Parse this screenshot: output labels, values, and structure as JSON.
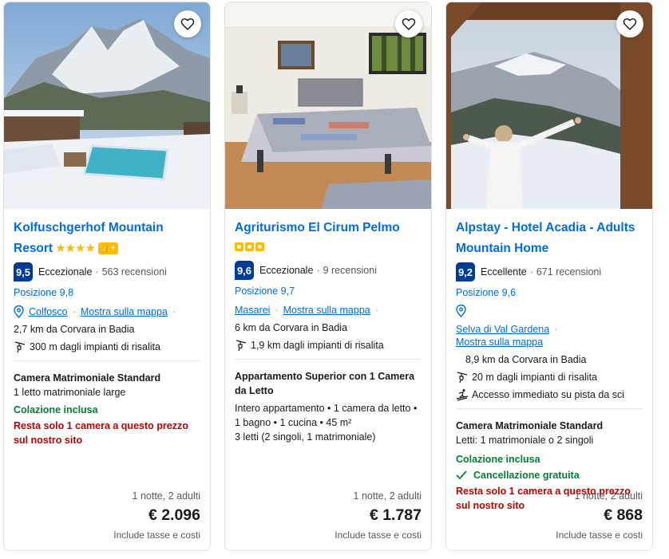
{
  "cards": [
    {
      "name": "Kolfuschgerhof Mountain Resort",
      "stars": "★★★★",
      "badge": "👍+",
      "score": "9,5",
      "score_word": "Eccezionale",
      "reviews": "563 recensioni",
      "position": "Posizione 9,8",
      "location_link": "Colfosco",
      "map_link": "Mostra sulla mappa",
      "distance_town": "2,7 km da Corvara in Badia",
      "distance_lift": "300 m dagli impianti di risalita",
      "room_title": "Camera Matrimoniale Standard",
      "room_beds": "1 letto matrimoniale large",
      "breakfast": "Colazione inclusa",
      "scarcity": "Resta solo 1 camera a questo prezzo sul nostro sito",
      "nights": "1 notte, 2 adulti",
      "price": "€ 2.096",
      "taxes": "Include tasse e costi"
    },
    {
      "name": "Agriturismo El Cirum Pelmo",
      "score": "9,6",
      "score_word": "Eccezionale",
      "reviews": "9 recensioni",
      "position": "Posizione 9,7",
      "location_link": "Masarei",
      "map_link": "Mostra sulla mappa",
      "distance_town": "6 km da Corvara in Badia",
      "distance_lift": "1,9 km dagli impianti di risalita",
      "room_title": "Appartamento Superior con 1 Camera da Letto",
      "room_detail": "Intero appartamento • 1 camera da letto • 1 bagno • 1 cucina • 45 m²",
      "room_beds": "3 letti (2 singoli, 1 matrimoniale)",
      "nights": "1 notte, 2 adulti",
      "price": "€ 1.787",
      "taxes": "Include tasse e costi"
    },
    {
      "name": "Alpstay - Hotel Acadia - Adults Mountain Home",
      "score": "9,2",
      "score_word": "Eccellente",
      "reviews": "671 recensioni",
      "position": "Posizione 9,6",
      "location_link": "Selva di Val Gardena",
      "map_link": "Mostra sulla mappa",
      "distance_town": "8,9 km da Corvara in Badia",
      "distance_lift": "20 m dagli impianti di risalita",
      "ski_access": "Accesso immediato su pista da sci",
      "room_title": "Camera Matrimoniale Standard",
      "room_beds": "Letti: 1 matrimoniale o 2 singoli",
      "breakfast": "Colazione inclusa",
      "cancellation": "Cancellazione gratuita",
      "scarcity": "Resta solo 1 camera a questo prezzo sul nostro sito",
      "nights": "1 notte, 2 adulti",
      "price": "€ 868",
      "taxes": "Include tasse e costi"
    }
  ],
  "colors": {
    "link_blue": "#006ce4",
    "score_blue": "#003b95",
    "green": "#008234",
    "red": "#c00000",
    "star_yellow": "#febb02"
  }
}
